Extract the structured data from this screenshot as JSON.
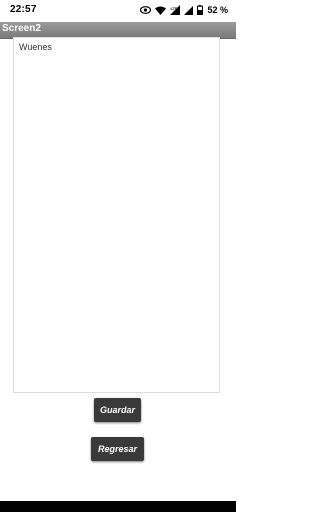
{
  "status_bar": {
    "time": "22:57",
    "network_label": "LTE",
    "battery": "52 %",
    "icons": [
      "eye-icon",
      "wifi-icon",
      "lte-signal-icon",
      "signal-icon",
      "battery-icon"
    ]
  },
  "title_bar": {
    "title": "Screen2",
    "background": "#888888"
  },
  "text_area": {
    "value": "Wuenes"
  },
  "buttons": {
    "save_label": "Guardar",
    "back_label": "Regresar",
    "color": "#3a3a3a"
  }
}
